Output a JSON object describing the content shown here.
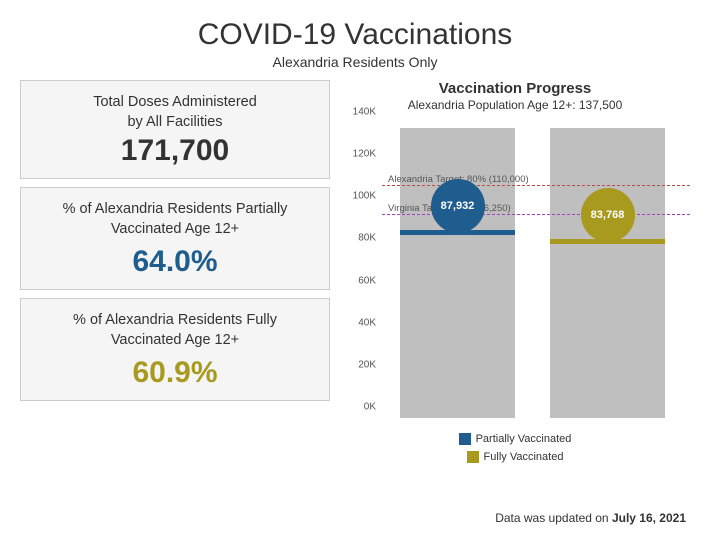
{
  "header": {
    "title": "COVID-19 Vaccinations",
    "subtitle": "Alexandria Residents Only"
  },
  "metrics": {
    "total_doses": {
      "label_line1": "Total Doses Administered",
      "label_line2": "by All Facilities",
      "value": "171,700"
    },
    "partial": {
      "label_line1": "% of Alexandria Residents Partially",
      "label_line2": "Vaccinated Age 12+",
      "value": "64.0%"
    },
    "fully": {
      "label_line1": "% of Alexandria Residents Fully",
      "label_line2": "Vaccinated Age 12+",
      "value": "60.9%"
    }
  },
  "chart": {
    "title": "Vaccination Progress",
    "subtitle": "Alexandria Population Age 12+: 137,500",
    "y_ticks": [
      "0K",
      "20K",
      "40K",
      "60K",
      "80K",
      "100K",
      "120K",
      "140K"
    ],
    "targets": {
      "alexandria": {
        "label": "Alexandria Target: 80% (110,000)",
        "value": 110000
      },
      "virginia": {
        "label": "Virginia Target: 70% (96,250)",
        "value": 96250
      }
    },
    "legend": {
      "partial": "Partially Vaccinated",
      "fully": "Fully Vaccinated"
    }
  },
  "chart_data": {
    "type": "bar",
    "categories": [
      "Partially Vaccinated",
      "Fully Vaccinated"
    ],
    "values": [
      87932,
      83768
    ],
    "value_labels": [
      "87,932",
      "83,768"
    ],
    "background_bar_value": 137500,
    "title": "Vaccination Progress",
    "xlabel": "",
    "ylabel": "",
    "ylim": [
      0,
      140000
    ],
    "reference_lines": [
      {
        "label": "Alexandria Target: 80% (110,000)",
        "value": 110000
      },
      {
        "label": "Virginia Target: 70% (96,250)",
        "value": 96250
      }
    ],
    "series_colors": [
      "#1f5d8e",
      "#a8991f"
    ]
  },
  "footer": {
    "prefix": "Data was updated on ",
    "date": "July 16, 2021"
  }
}
